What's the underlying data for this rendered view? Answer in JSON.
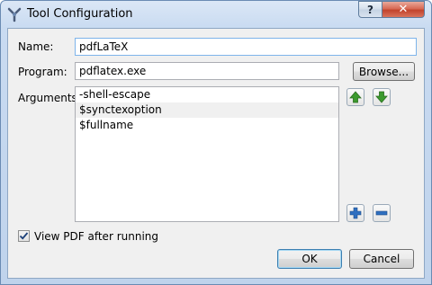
{
  "window": {
    "title": "Tool Configuration",
    "help_label": "?",
    "close_label": "✕"
  },
  "form": {
    "name_label": "Name:",
    "name_value": "pdfLaTeX",
    "program_label": "Program:",
    "program_value": "pdflatex.exe",
    "browse_label": "Browse...",
    "arguments_label": "Arguments:",
    "arguments": [
      "-shell-escape",
      "$synctexoption",
      "$fullname"
    ],
    "selected_argument_index": 1,
    "view_pdf_label": "View PDF after running",
    "view_pdf_checked": true
  },
  "buttons": {
    "ok_label": "OK",
    "cancel_label": "Cancel"
  },
  "colors": {
    "arrow_green": "#3c9a2e",
    "plus_minus_blue": "#2f6fc0"
  }
}
